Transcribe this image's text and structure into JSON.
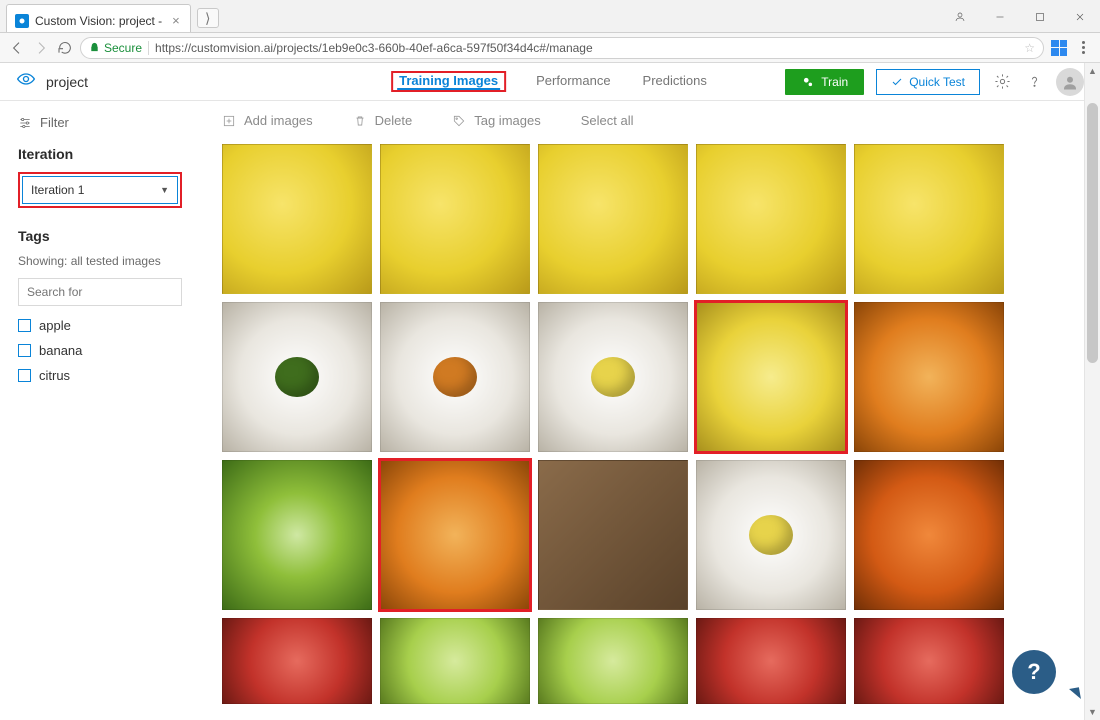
{
  "browser": {
    "tab_title": "Custom Vision: project -",
    "secure_label": "Secure",
    "url": "https://customvision.ai/projects/1eb9e0c3-660b-40ef-a6ca-597f50f34d4c#/manage"
  },
  "header": {
    "project_name": "project",
    "tabs": {
      "training": "Training Images",
      "performance": "Performance",
      "predictions": "Predictions"
    },
    "train_label": "Train",
    "quick_test_label": "Quick Test"
  },
  "sidebar": {
    "filter_label": "Filter",
    "iteration_label": "Iteration",
    "iteration_selected": "Iteration 1",
    "tags_label": "Tags",
    "tags_subtext": "Showing: all tested images",
    "search_placeholder": "Search for",
    "tags": [
      "apple",
      "banana",
      "citrus"
    ]
  },
  "actions": {
    "add": "Add images",
    "delete": "Delete",
    "tag": "Tag images",
    "select_all": "Select all"
  },
  "grid": {
    "columns": 5,
    "items": [
      {
        "cls": "banana",
        "sel": false
      },
      {
        "cls": "banana",
        "sel": false
      },
      {
        "cls": "banana",
        "sel": false
      },
      {
        "cls": "banana",
        "sel": false
      },
      {
        "cls": "banana",
        "sel": false
      },
      {
        "cls": "plate",
        "sel": false,
        "accent": "#3f6d1d"
      },
      {
        "cls": "plate",
        "sel": false,
        "accent": "#d07a22"
      },
      {
        "cls": "plate",
        "sel": false,
        "accent": "#e7d34b"
      },
      {
        "cls": "lemon",
        "sel": true
      },
      {
        "cls": "orange",
        "sel": false
      },
      {
        "cls": "lime",
        "sel": false
      },
      {
        "cls": "orange",
        "sel": true
      },
      {
        "cls": "box",
        "sel": false
      },
      {
        "cls": "plate",
        "sel": false,
        "accent": "#e7d34b"
      },
      {
        "cls": "tangerine",
        "sel": false
      },
      {
        "cls": "apple-r",
        "sel": false,
        "short": true
      },
      {
        "cls": "apple-g",
        "sel": false,
        "short": true
      },
      {
        "cls": "apple-g",
        "sel": false,
        "short": true
      },
      {
        "cls": "apple-r",
        "sel": false,
        "short": true
      },
      {
        "cls": "apple-r",
        "sel": false,
        "short": true
      }
    ]
  },
  "help": "?"
}
